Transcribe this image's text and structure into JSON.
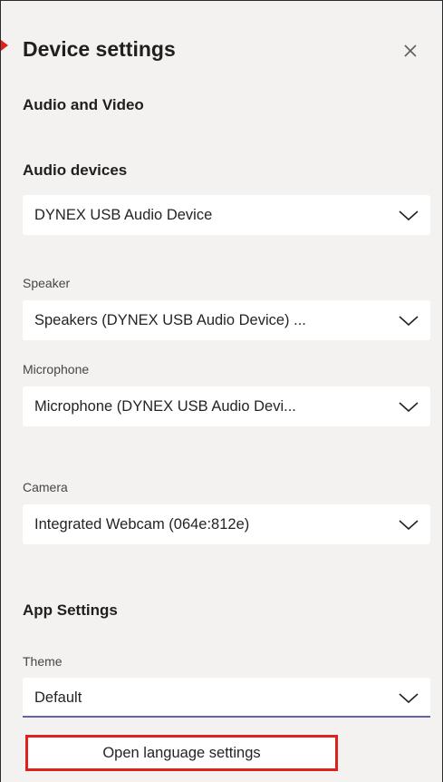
{
  "header": {
    "title": "Device settings",
    "close_icon": "close-icon"
  },
  "sections": {
    "audio_video": "Audio and Video",
    "audio_devices": "Audio devices",
    "app_settings": "App Settings"
  },
  "audio_device": {
    "value": "DYNEX USB Audio Device"
  },
  "speaker": {
    "label": "Speaker",
    "value": "Speakers (DYNEX USB Audio Device) ..."
  },
  "microphone": {
    "label": "Microphone",
    "value": "Microphone (DYNEX USB Audio Devi..."
  },
  "camera": {
    "label": "Camera",
    "value": "Integrated Webcam (064e:812e)"
  },
  "theme": {
    "label": "Theme",
    "value": "Default",
    "underline_color": "#6264a7"
  },
  "language": {
    "button_label": "Open language settings",
    "highlight_color": "#e0201b"
  },
  "icons": {
    "dropdown": "chevron-down-icon"
  }
}
